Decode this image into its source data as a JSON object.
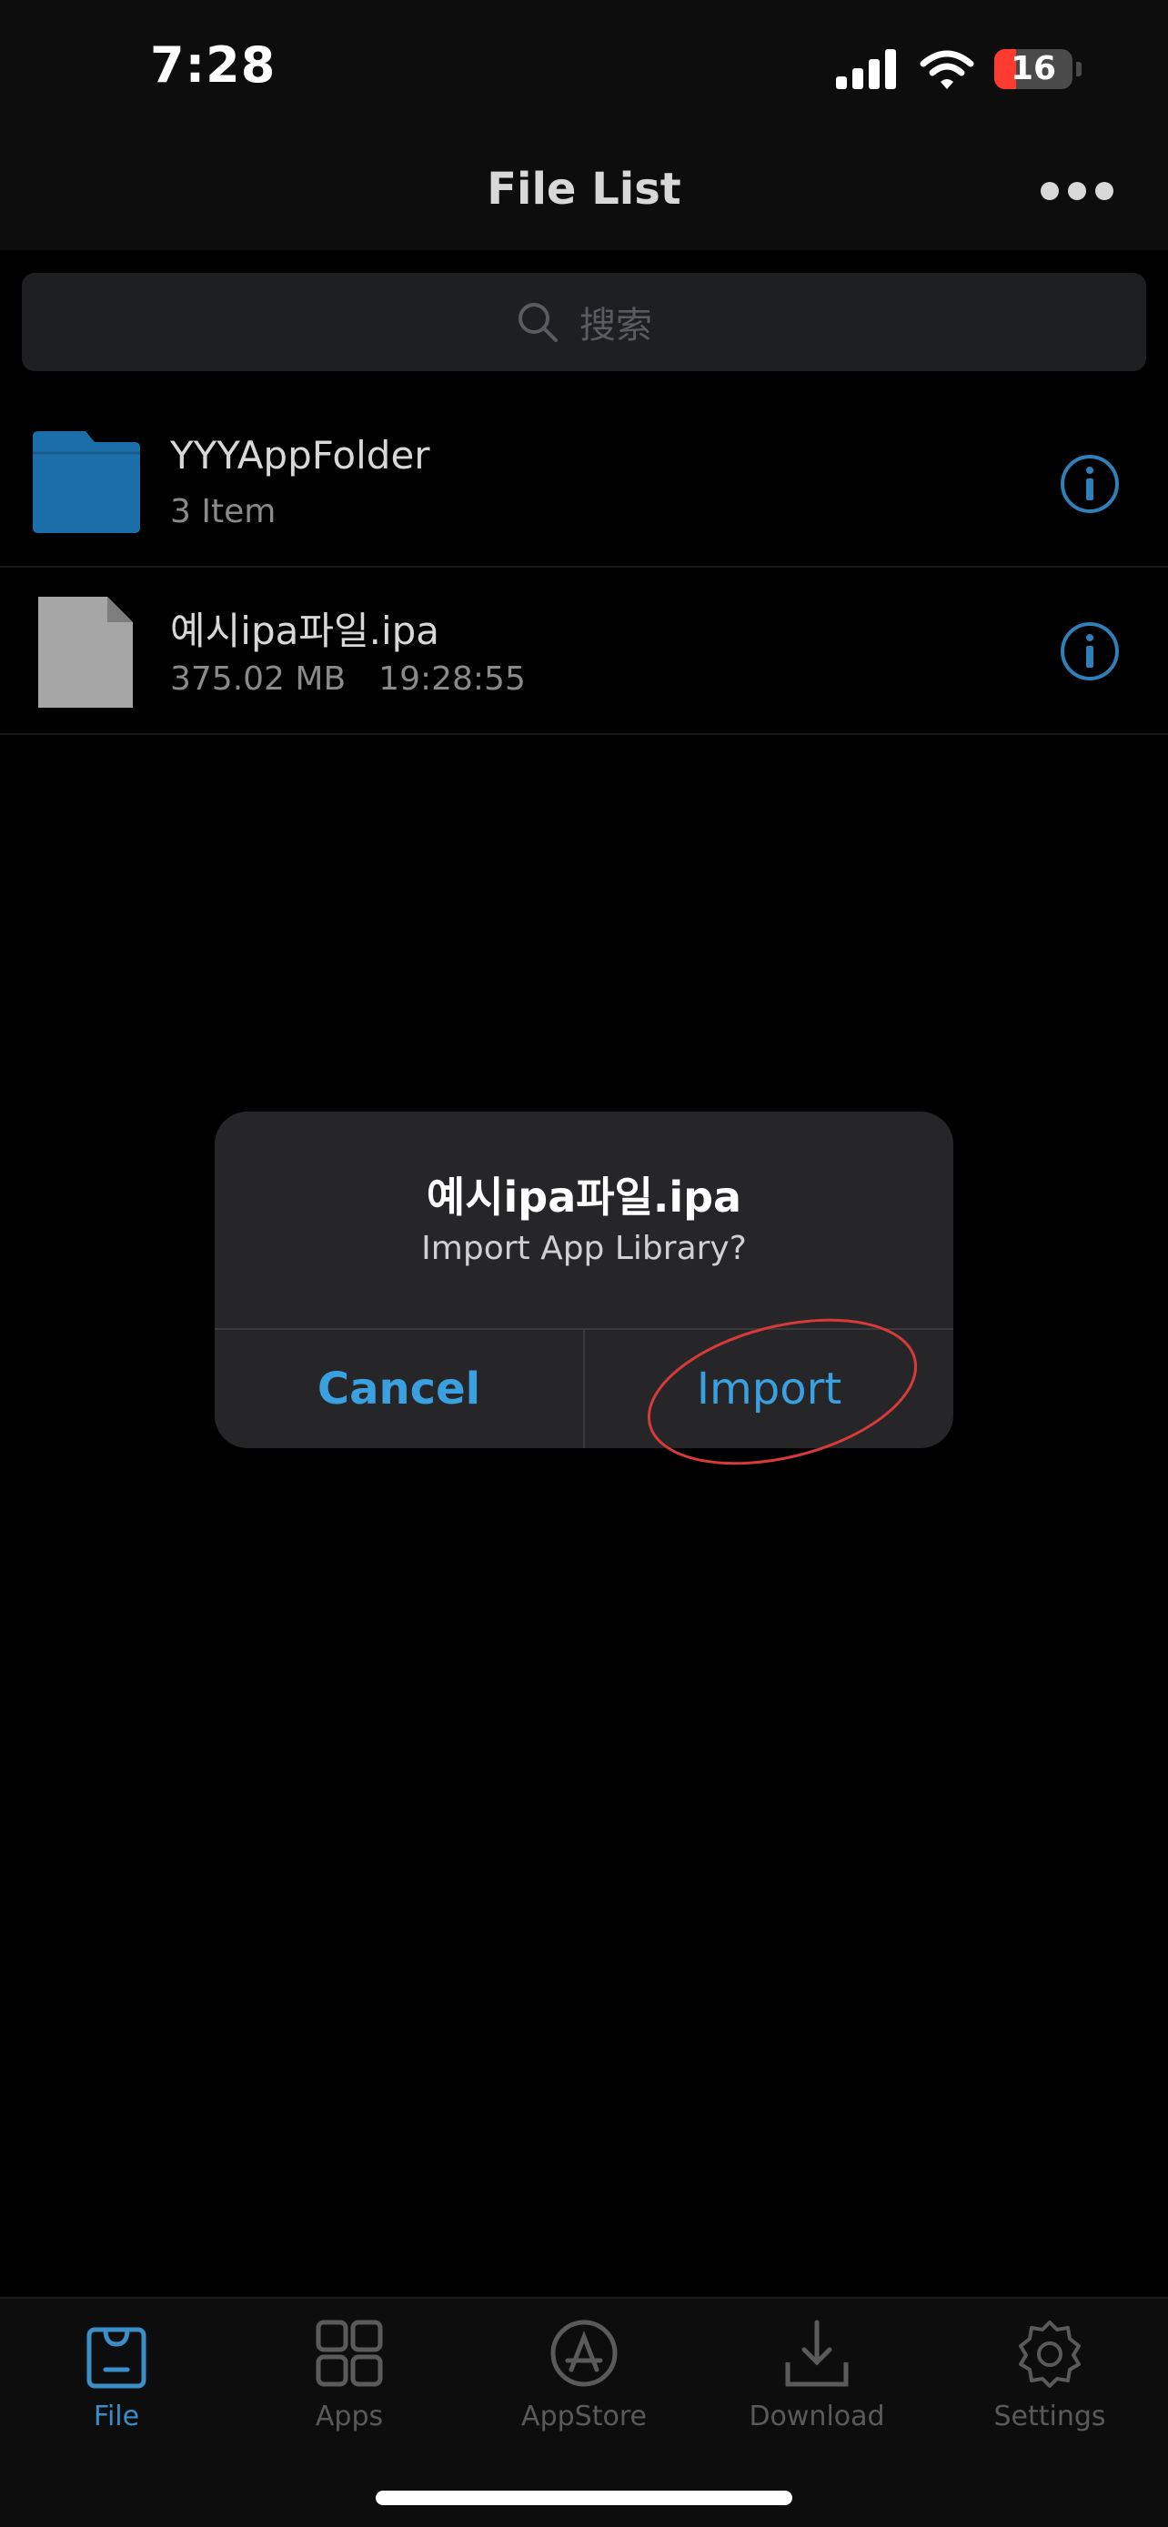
{
  "status_bar": {
    "time": "7:28",
    "battery_level": "16",
    "battery_fraction": 0.16,
    "icons": [
      "cellular-signal-icon",
      "wifi-icon",
      "battery-icon"
    ]
  },
  "nav": {
    "title": "File List",
    "more_icon": "ellipsis-icon"
  },
  "search": {
    "placeholder": "搜索"
  },
  "files": [
    {
      "name": "YYYAppFolder",
      "sub": "3 Item",
      "type": "folder"
    },
    {
      "name": "예시ipa파일.ipa",
      "size": "375.02 MB",
      "time": "19:28:55",
      "type": "file"
    }
  ],
  "dialog": {
    "title": "예시ipa파일.ipa",
    "message": "Import App Library?",
    "cancel_label": "Cancel",
    "import_label": "Import"
  },
  "tabs": [
    {
      "label": "File",
      "icon": "file-bag-icon",
      "active": true
    },
    {
      "label": "Apps",
      "icon": "apps-grid-icon",
      "active": false
    },
    {
      "label": "AppStore",
      "icon": "appstore-icon",
      "active": false
    },
    {
      "label": "Download",
      "icon": "download-icon",
      "active": false
    },
    {
      "label": "Settings",
      "icon": "gear-icon",
      "active": false
    }
  ],
  "colors": {
    "accent": "#3aa0e0",
    "tab_active": "#3a8fc9",
    "folder": "#1a6fa8",
    "annotation": "#d83a3a",
    "battery_low": "#ff3b30"
  }
}
